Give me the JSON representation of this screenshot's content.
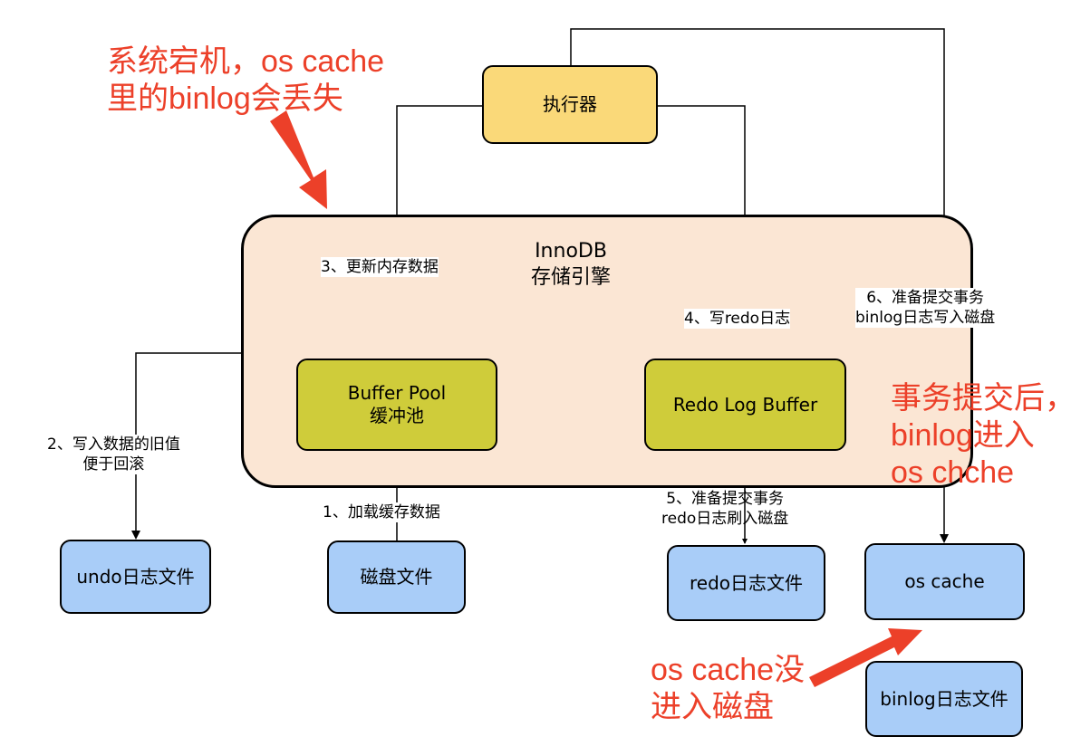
{
  "diagram": {
    "nodes": {
      "executor": "执行器",
      "innodb_title": "InnoDB",
      "innodb_subtitle": "存储引擎",
      "buffer_pool_line1": "Buffer Pool",
      "buffer_pool_line2": "缓冲池",
      "redo_log_buffer": "Redo Log Buffer",
      "undo_file": "undo日志文件",
      "disk_file": "磁盘文件",
      "redo_file": "redo日志文件",
      "os_cache": "os cache",
      "binlog_file": "binlog日志文件"
    },
    "edges": {
      "step1": "1、加载缓存数据",
      "step2_line1": "2、写入数据的旧值",
      "step2_line2": "便于回滚",
      "step3": "3、更新内存数据",
      "step4": "4、写redo日志",
      "step5_line1": "5、准备提交事务",
      "step5_line2": "redo日志刷入磁盘",
      "step6_line1": "6、准备提交事务",
      "step6_line2": "binlog日志写入磁盘"
    },
    "annotations": {
      "crash_line1": "系统宕机，os cache",
      "crash_line2": "里的binlog会丢失",
      "commit_line1": "事务提交后，",
      "commit_line2": "binlog进入",
      "commit_line3": "os chche",
      "not_flushed_line1": "os cache没",
      "not_flushed_line2": "进入磁盘"
    },
    "colors": {
      "annotation_red": "#ec4029",
      "innodb_fill": "#fbe6d4",
      "executor_fill": "#fad979",
      "buffer_fill": "#cfcc3a",
      "file_fill": "#a9cdf8"
    }
  }
}
